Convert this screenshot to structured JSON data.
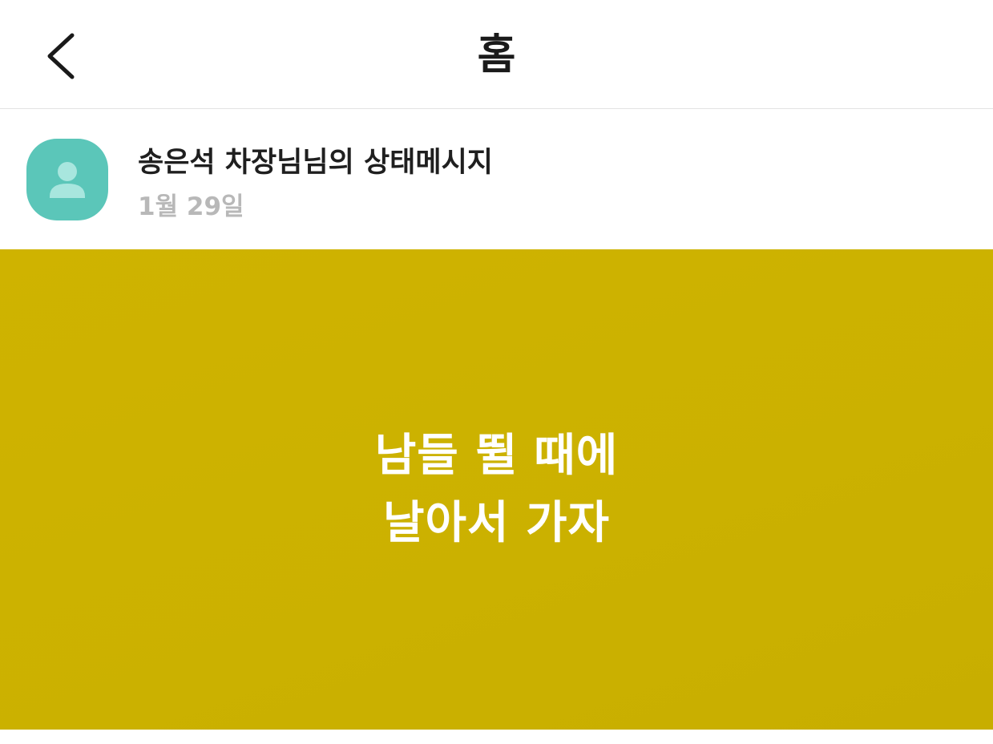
{
  "header": {
    "title": "홈",
    "back_icon": "chevron-left-icon"
  },
  "profile": {
    "avatar_icon": "person-icon",
    "avatar_color": "#5bc6b9",
    "name": "송은석 차장님님의 상태메시지",
    "date": "1월 29일"
  },
  "status": {
    "background_color": "#cbb100",
    "text_color": "#ffffff",
    "lines": [
      "남들 뛸 때에",
      "날아서 가자"
    ]
  }
}
